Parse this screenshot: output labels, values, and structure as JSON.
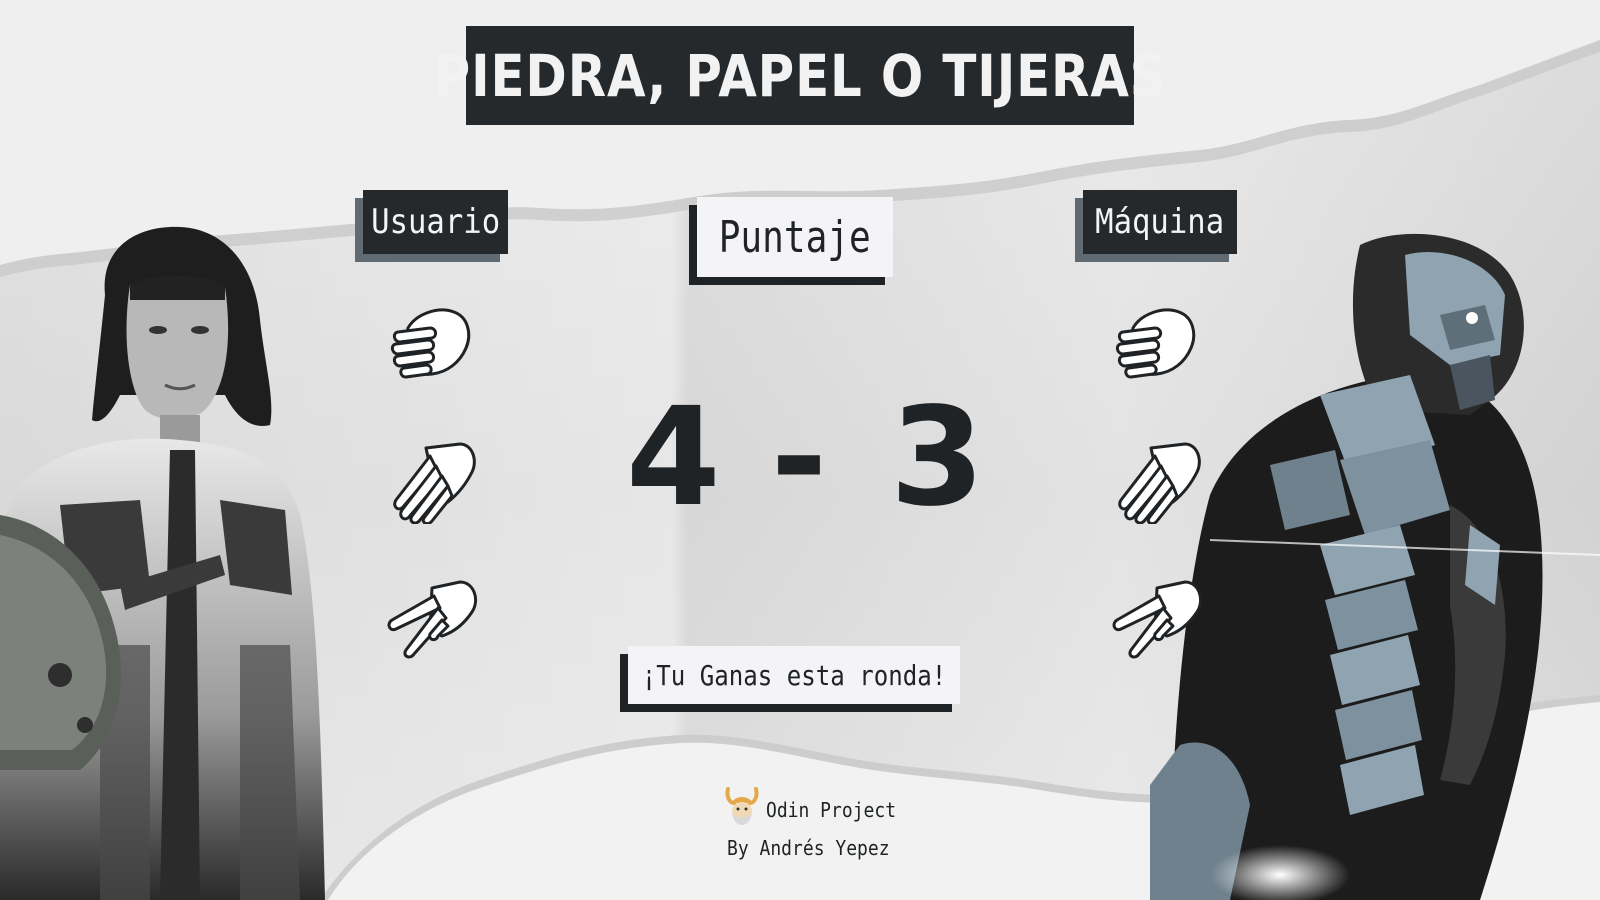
{
  "game": {
    "title": "PIEDRA, PAPEL O TIJERAS",
    "user_label": "Usuario",
    "machine_label": "Máquina",
    "score_label": "Puntaje",
    "round_message": "¡Tu Ganas esta ronda!"
  },
  "score": {
    "user": "4",
    "separator": "-",
    "machine": "3"
  },
  "choices": {
    "user": [
      "rock",
      "paper",
      "scissors"
    ],
    "machine": [
      "rock",
      "paper",
      "scissors"
    ]
  },
  "footer": {
    "project": "Odin Project",
    "author": "By Andrés Yepez"
  },
  "colors": {
    "dark_box": "#25292c",
    "shadow_gray": "#5f6a72",
    "light_box": "#f4f4f6",
    "text_dark": "#1f2326",
    "paper_bg": "#dcdcdc",
    "armor_blue": "#8fa3b0"
  },
  "icons": {
    "rock": "fist-icon",
    "paper": "open-hand-icon",
    "scissors": "two-fingers-icon",
    "logo": "viking-helmet-icon"
  }
}
